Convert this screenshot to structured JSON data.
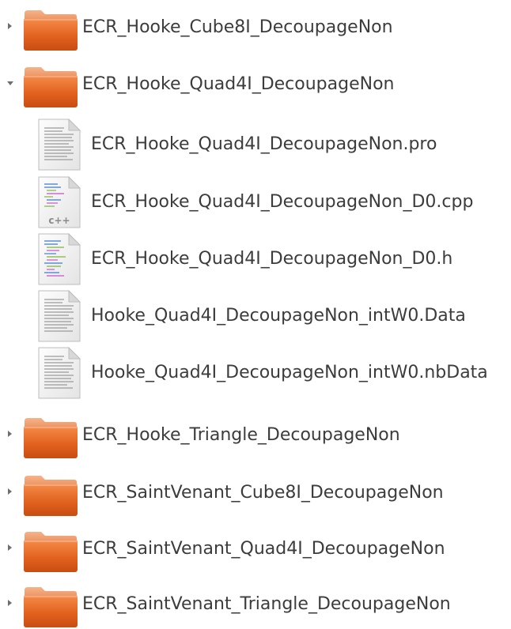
{
  "tree": {
    "items": [
      {
        "name": "ECR_Hooke_Cube8I_DecoupageNon",
        "type": "folder",
        "expanded": false
      },
      {
        "name": "ECR_Hooke_Quad4I_DecoupageNon",
        "type": "folder",
        "expanded": true
      },
      {
        "name": "ECR_Hooke_Quad4I_DecoupageNon.pro",
        "type": "text-file"
      },
      {
        "name": "ECR_Hooke_Quad4I_DecoupageNon_D0.cpp",
        "type": "cpp-file",
        "icon_label": "c++"
      },
      {
        "name": "ECR_Hooke_Quad4I_DecoupageNon_D0.h",
        "type": "header-file"
      },
      {
        "name": "Hooke_Quad4I_DecoupageNon_intW0.Data",
        "type": "text-file"
      },
      {
        "name": "Hooke_Quad4I_DecoupageNon_intW0.nbData",
        "type": "text-file"
      },
      {
        "name": "ECR_Hooke_Triangle_DecoupageNon",
        "type": "folder",
        "expanded": false
      },
      {
        "name": "ECR_SaintVenant_Cube8I_DecoupageNon",
        "type": "folder",
        "expanded": false
      },
      {
        "name": "ECR_SaintVenant_Quad4I_DecoupageNon",
        "type": "folder",
        "expanded": false
      },
      {
        "name": "ECR_SaintVenant_Triangle_DecoupageNon",
        "type": "folder",
        "expanded": false
      }
    ]
  },
  "colors": {
    "folder_top": "#f0a070",
    "folder_body": "#e06424",
    "text": "#3c3c3c",
    "expander": "#6e6e6e"
  }
}
